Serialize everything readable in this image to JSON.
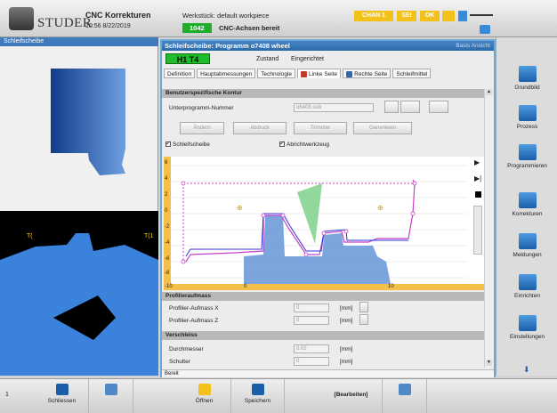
{
  "header": {
    "logo": "STUDER",
    "app_title": "CNC Korrekturen",
    "clock": "10:56 8/22/2019",
    "workpiece": "Werkstück: default workpiece",
    "status_num": "1042",
    "status_text": "CNC-Achsen bereit",
    "chan_btn": "CHAN 1",
    "sei_btn": "SEI",
    "ok_btn": "OK"
  },
  "left_panel": {
    "title": "Schleifscheibe",
    "label_left": "T(",
    "label_right": "T(1"
  },
  "main": {
    "title": "Schleifscheibe: Programm o7408 wheel",
    "basis": "Basis Ansicht",
    "tool": "H1 T4",
    "zustand_label": "Zustand",
    "zustand_value": "Eingerichtet",
    "tabs": [
      "Definition",
      "Hauptabmessungen",
      "Technologie",
      "Linke Seite",
      "Rechte Seite",
      "Schleifmittel"
    ],
    "section_contour": "Benutzerspezifische Kontur",
    "upn_label": "Unterprogramm-Nummer",
    "upn_value": "o6408.sub",
    "btn_aendern": "Ändern",
    "btn_abdruck": "Abdruck",
    "btn_trimmer": "Trimmer",
    "btn_generieren": "Generieren",
    "cb_schleifscheibe": "Schleifscheibe",
    "cb_abrichtwerkzeug": "Abrichtwerkzeug",
    "graph_ylabels": [
      "6",
      "4",
      "2",
      "0",
      "-2",
      "-4",
      "-6",
      "-8",
      "-10"
    ],
    "graph_xlabels": [
      "0",
      "10"
    ],
    "section_profil": "Profilieraufmass",
    "profil_x_label": "Profilier-Aufmass X",
    "profil_x_value": "0",
    "profil_z_label": "Profilier-Aufmass Z",
    "profil_z_value": "0",
    "unit_mm": "[mm]",
    "section_verschleiss": "Verschleiss",
    "durchmesser_label": "Durchmesser",
    "durchmesser_value": "0.02",
    "schulter_label": "Schulter",
    "schulter_value": "0",
    "status": "Bereit"
  },
  "rightbar": [
    "Grundbild",
    "Prozess",
    "Programmieren",
    "Korrekturen",
    "Meldungen",
    "Einrichten",
    "Einstellungen"
  ],
  "bottombar": {
    "index": "1",
    "schliessen": "Schliessen",
    "oeffnen": "Öffnen",
    "speichern": "Speichern",
    "bearbeiten": "[Bearbeiten]"
  },
  "colors": {
    "accent": "#3d7bbd",
    "status_green": "#1fae2a",
    "warn_yellow": "#f3c21a",
    "profile_blue": "#5b8fd6"
  }
}
